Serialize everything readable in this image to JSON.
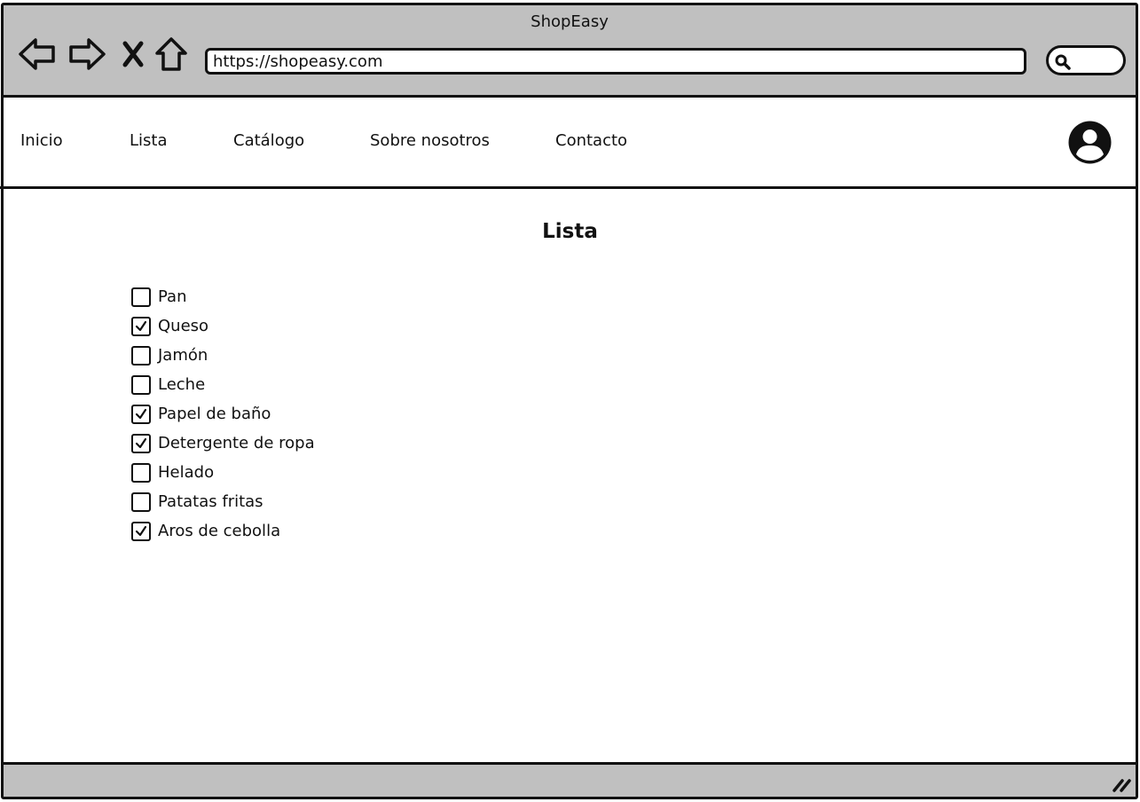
{
  "window": {
    "title": "ShopEasy"
  },
  "browser": {
    "url": "https://shopeasy.com",
    "icons": {
      "back": "back-arrow-icon",
      "forward": "forward-arrow-icon",
      "stop": "close-icon",
      "home": "home-icon",
      "search": "search-icon"
    }
  },
  "nav": {
    "links": [
      "Inicio",
      "Lista",
      "Catálogo",
      "Sobre nosotros",
      "Contacto"
    ],
    "profile_icon": "user-avatar-icon"
  },
  "main": {
    "title": "Lista",
    "items": [
      {
        "label": "Pan",
        "checked": false
      },
      {
        "label": "Queso",
        "checked": true
      },
      {
        "label": "Jamón",
        "checked": false
      },
      {
        "label": "Leche",
        "checked": false
      },
      {
        "label": "Papel de baño",
        "checked": true
      },
      {
        "label": "Detergente de ropa",
        "checked": true
      },
      {
        "label": "Helado",
        "checked": false
      },
      {
        "label": "Patatas fritas",
        "checked": false
      },
      {
        "label": "Aros de cebolla",
        "checked": true
      }
    ]
  },
  "colors": {
    "chrome": "#c0c0c0",
    "ink": "#111111",
    "background": "#ffffff"
  }
}
